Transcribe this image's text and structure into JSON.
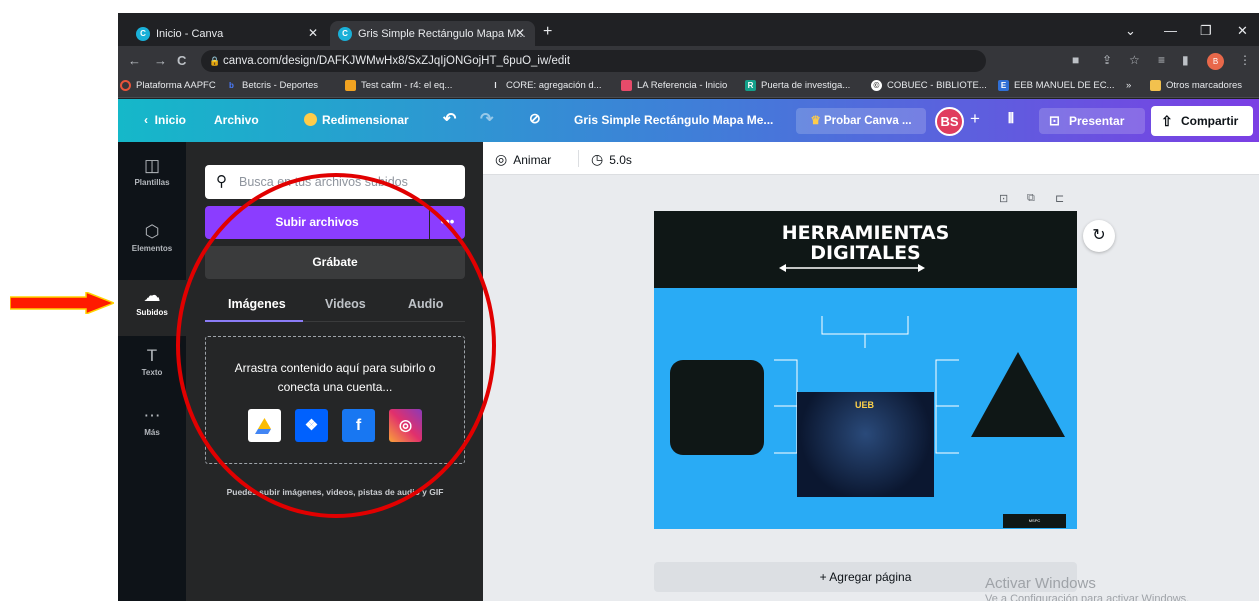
{
  "browser": {
    "tabs": [
      {
        "label": "Inicio - Canva"
      },
      {
        "label": "Gris Simple Rectángulo Mapa M..."
      }
    ],
    "new_tab": "+",
    "window_controls": {
      "minimize": "—",
      "restore": "❐",
      "close": "✕",
      "menu": "⌄"
    },
    "address": "canva.com/design/DAFKJWMwHx8/SxZJqIjONGojHT_6puO_iw/edit",
    "profile_initial": "B",
    "bookmarks": [
      {
        "label": "Plataforma AAPFC"
      },
      {
        "label": "Betcris - Deportes"
      },
      {
        "label": "Test cafm - r4: el eq..."
      },
      {
        "label": "CORE: agregación d..."
      },
      {
        "label": "LA Referencia - Inicio"
      },
      {
        "label": "Puerta de investiga..."
      },
      {
        "label": "COBUEC - BIBLIOTE..."
      },
      {
        "label": "EEB MANUEL DE EC..."
      },
      {
        "label": "»"
      },
      {
        "label": "Otros marcadores"
      }
    ]
  },
  "canva_header": {
    "home": "Inicio",
    "file": "Archivo",
    "resize": "Redimensionar",
    "doc_title": "Gris Simple Rectángulo Mapa Me...",
    "try_pro": "Probar Canva ...",
    "avatar_initials": "BS",
    "add": "+",
    "present": "Presentar",
    "share": "Compartir"
  },
  "rail": [
    {
      "label": "Plantillas",
      "icon": "templates-icon"
    },
    {
      "label": "Elementos",
      "icon": "elements-icon"
    },
    {
      "label": "Subidos",
      "icon": "upload-cloud-icon"
    },
    {
      "label": "Texto",
      "icon": "text-icon"
    },
    {
      "label": "Más",
      "icon": "more-icon"
    }
  ],
  "panel": {
    "search_placeholder": "Busca en tus archivos subidos",
    "upload_button": "Subir archivos",
    "upload_more": "•••",
    "record_button": "Grábate",
    "tabs": [
      "Imágenes",
      "Videos",
      "Audio"
    ],
    "drop_text": "Arrastra contenido aquí para subirlo o conecta una cuenta...",
    "sources": [
      "google-drive-icon",
      "dropbox-icon",
      "facebook-icon",
      "instagram-icon"
    ],
    "hint": "Puedes subir imágenes, videos, pistas de audio y GIF"
  },
  "editor": {
    "animate": "Animar",
    "duration": "5.0s",
    "slide_title_line1": "HERRAMIENTAS",
    "slide_title_line2": "DIGITALES",
    "photo_caption": "UEB",
    "slide_footer": "MSPC",
    "add_page": "+ Agregar página"
  },
  "watermark": {
    "line1": "Activar Windows",
    "line2": "Ve a Configuración para activar Windows."
  },
  "colors": {
    "canva_purple": "#8b3dff",
    "slide_blue": "#29abf5",
    "annotation_red": "#e10000"
  }
}
